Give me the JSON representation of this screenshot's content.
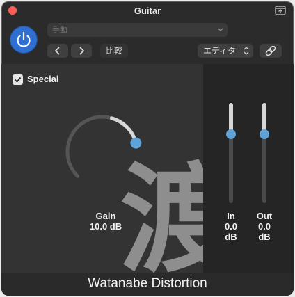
{
  "window": {
    "title": "Guitar"
  },
  "header": {
    "preset_select": "手動",
    "compare_label": "比較",
    "view_select": "エディタ"
  },
  "plugin": {
    "special_label": "Special",
    "special_checked": true,
    "watermark_glyph": "渡",
    "gain": {
      "label": "Gain",
      "value": "10.0 dB",
      "level": 1.0
    },
    "in": {
      "label": "In",
      "value": "0.0",
      "unit": "dB",
      "level": 0.69
    },
    "out": {
      "label": "Out",
      "value": "0.0",
      "unit": "dB",
      "level": 0.69
    },
    "name": "Watanabe Distortion"
  },
  "colors": {
    "accent": "#5ea2d8",
    "power": "#2f6fd0",
    "close": "#ff5f57"
  }
}
